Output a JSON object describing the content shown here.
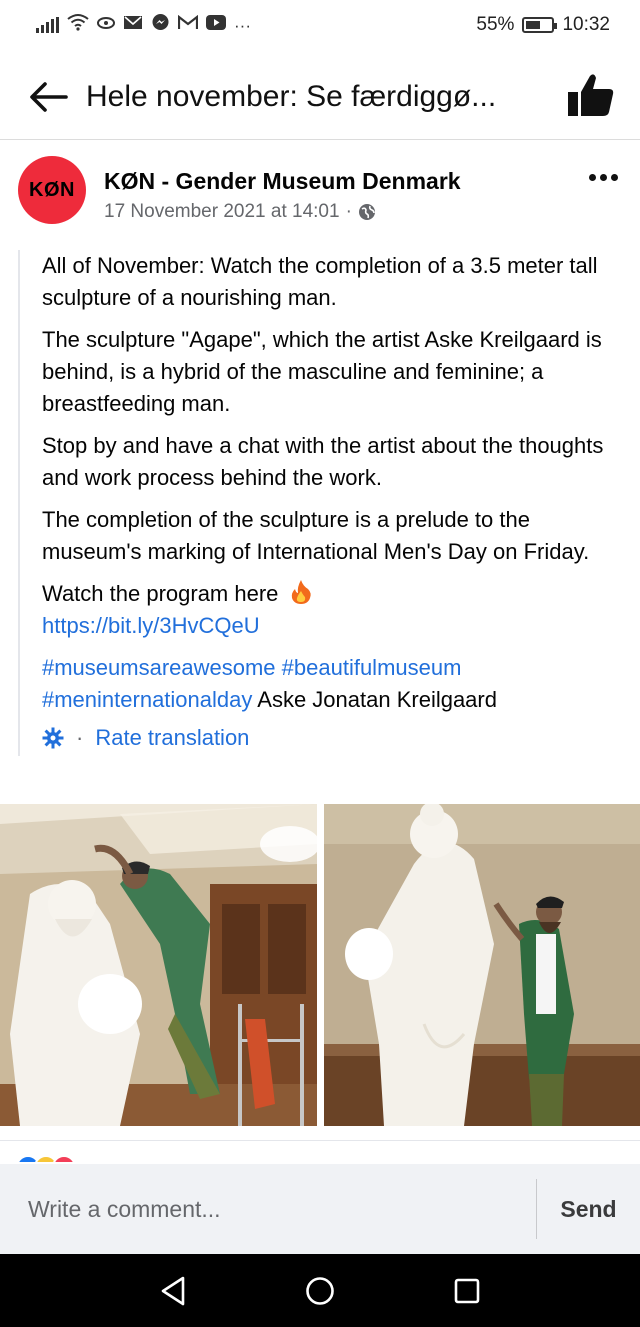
{
  "status_bar": {
    "battery": "55%",
    "battery_level": 0.55,
    "time": "10:32",
    "icons": [
      "signal-icon",
      "wifi-icon",
      "hotspot-icon",
      "mail-icon",
      "messenger-icon",
      "gmail-icon",
      "youtube-icon",
      "more-notifications-icon"
    ],
    "more": "···"
  },
  "header": {
    "title": "Hele november: Se færdiggø...",
    "back_icon": "arrow-left-icon",
    "like_icon": "thumbs-up-icon"
  },
  "post": {
    "avatar_text": "KØN",
    "avatar_color": "#ee2b3b",
    "page_name": "KØN - Gender Museum Denmark",
    "timestamp": "17 November 2021 at 14:01",
    "separator": "·",
    "privacy_icon": "globe-icon",
    "paragraphs": [
      "All of November: Watch the completion of a 3.5 meter tall sculpture of a nourishing man.",
      "The sculpture \"Agape\", which the artist Aske Kreilgaard is behind, is a hybrid of the masculine and feminine; a breastfeeding man.",
      "Stop by and have a chat with the artist about the thoughts and work process behind the work.",
      "The completion of the sculpture is a prelude to the museum's marking of International Men's Day on Friday."
    ],
    "program_text": "Watch the program here",
    "fire_icon": "fire-emoji-icon",
    "link": "https://bit.ly/3HvCQeU",
    "hashtags_line1": "#museumsareawesome #beautifulmuseum",
    "hashtag_line2": "#meninternationalday",
    "tagged_person": "Aske Jonatan Kreilgaard",
    "rate_separator": "·",
    "rate_translation": "Rate translation",
    "link_color": "#216fdb"
  },
  "photos": [
    {
      "name": "photo-artist-on-ladder"
    },
    {
      "name": "photo-artist-beside-sculpture"
    }
  ],
  "composer": {
    "placeholder": "Write a comment...",
    "send_label": "Send"
  },
  "navbar": {
    "back": "nav-back-icon",
    "home": "nav-home-icon",
    "recents": "nav-recents-icon"
  }
}
